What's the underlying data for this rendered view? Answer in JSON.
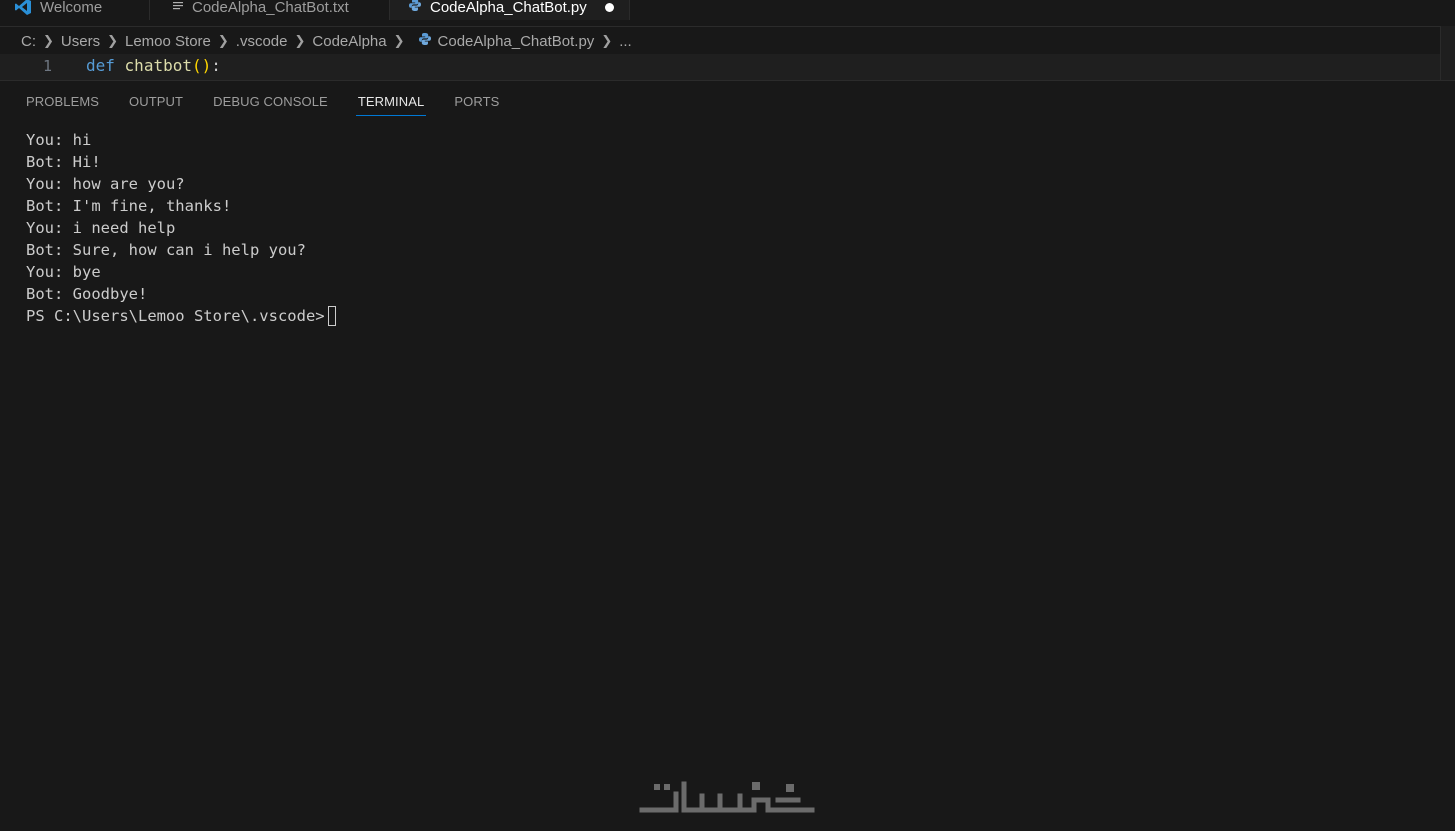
{
  "tabs": [
    {
      "label": "Welcome",
      "icon": "vscode-logo-icon"
    },
    {
      "label": "CodeAlpha_ChatBot.txt",
      "icon": "text-file-icon"
    },
    {
      "label": "CodeAlpha_ChatBot.py",
      "icon": "python-file-icon",
      "active": true,
      "modified": true
    }
  ],
  "breadcrumb": [
    "C:",
    "Users",
    "Lemoo Store",
    ".vscode",
    "CodeAlpha",
    "CodeAlpha_ChatBot.py",
    "..."
  ],
  "editor": {
    "line_number": "1",
    "code": {
      "keyword": "def",
      "function": "chatbot",
      "parens": "()",
      "colon": ":"
    }
  },
  "panel_tabs": [
    {
      "label": "PROBLEMS"
    },
    {
      "label": "OUTPUT"
    },
    {
      "label": "DEBUG CONSOLE"
    },
    {
      "label": "TERMINAL",
      "active": true
    },
    {
      "label": "PORTS"
    }
  ],
  "terminal": {
    "lines": [
      "You: hi",
      "Bot: Hi!",
      "You: how are you?",
      "Bot: I'm fine, thanks!",
      "You: i need help",
      "Bot: Sure, how can i help you?",
      "You: bye",
      "Bot: Goodbye!"
    ],
    "prompt": "PS C:\\Users\\Lemoo Store\\.vscode>"
  },
  "watermark": "خمسات",
  "colors": {
    "background": "#181818",
    "accent": "#0078d4",
    "keyword": "#569cd6",
    "function": "#dcdcaa",
    "bracket": "#ffd700"
  }
}
